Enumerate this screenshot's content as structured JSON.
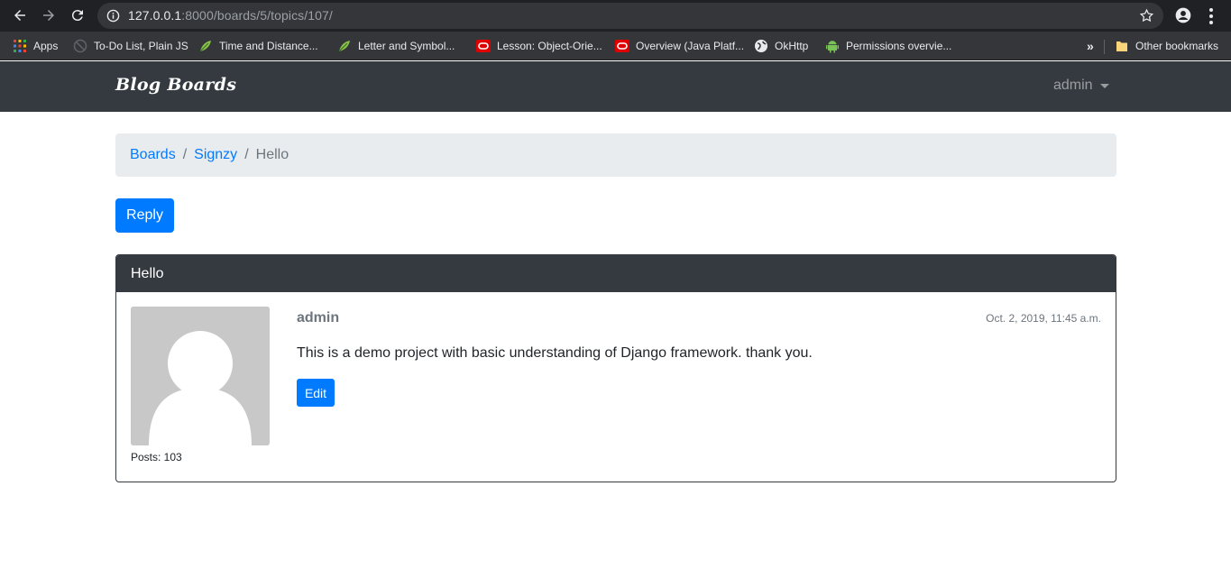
{
  "browser": {
    "url_host": "127.0.0.1",
    "url_path": ":8000/boards/5/topics/107/",
    "bookmarks": [
      {
        "label": "Apps",
        "icon": "apps-grid-icon"
      },
      {
        "label": "To-Do List, Plain JS",
        "icon": "blocked-icon"
      },
      {
        "label": "Time and Distance...",
        "icon": "leaf-icon"
      },
      {
        "label": "Letter and Symbol...",
        "icon": "leaf-icon"
      },
      {
        "label": "Lesson: Object-Orie...",
        "icon": "oracle-icon"
      },
      {
        "label": "Overview (Java Platf...",
        "icon": "oracle-icon"
      },
      {
        "label": "OkHttp",
        "icon": "globe-icon"
      },
      {
        "label": "Permissions overvie...",
        "icon": "android-icon"
      }
    ],
    "overflow_label": "»",
    "other_bookmarks": "Other bookmarks"
  },
  "navbar": {
    "brand": "Blog Boards",
    "user": "admin"
  },
  "breadcrumb": {
    "items": [
      "Boards",
      "Signzy"
    ],
    "active": "Hello",
    "separator": "/"
  },
  "actions": {
    "reply": "Reply"
  },
  "post": {
    "title": "Hello",
    "author": "admin",
    "date": "Oct. 2, 2019, 11:45 a.m.",
    "message": "This is a demo project with basic understanding of Django framework. thank you.",
    "posts_count": "Posts: 103",
    "edit": "Edit"
  },
  "colors": {
    "primary": "#007bff",
    "dark": "#343a40",
    "breadcrumb_bg": "#e9ecef",
    "muted": "#6c757d"
  }
}
